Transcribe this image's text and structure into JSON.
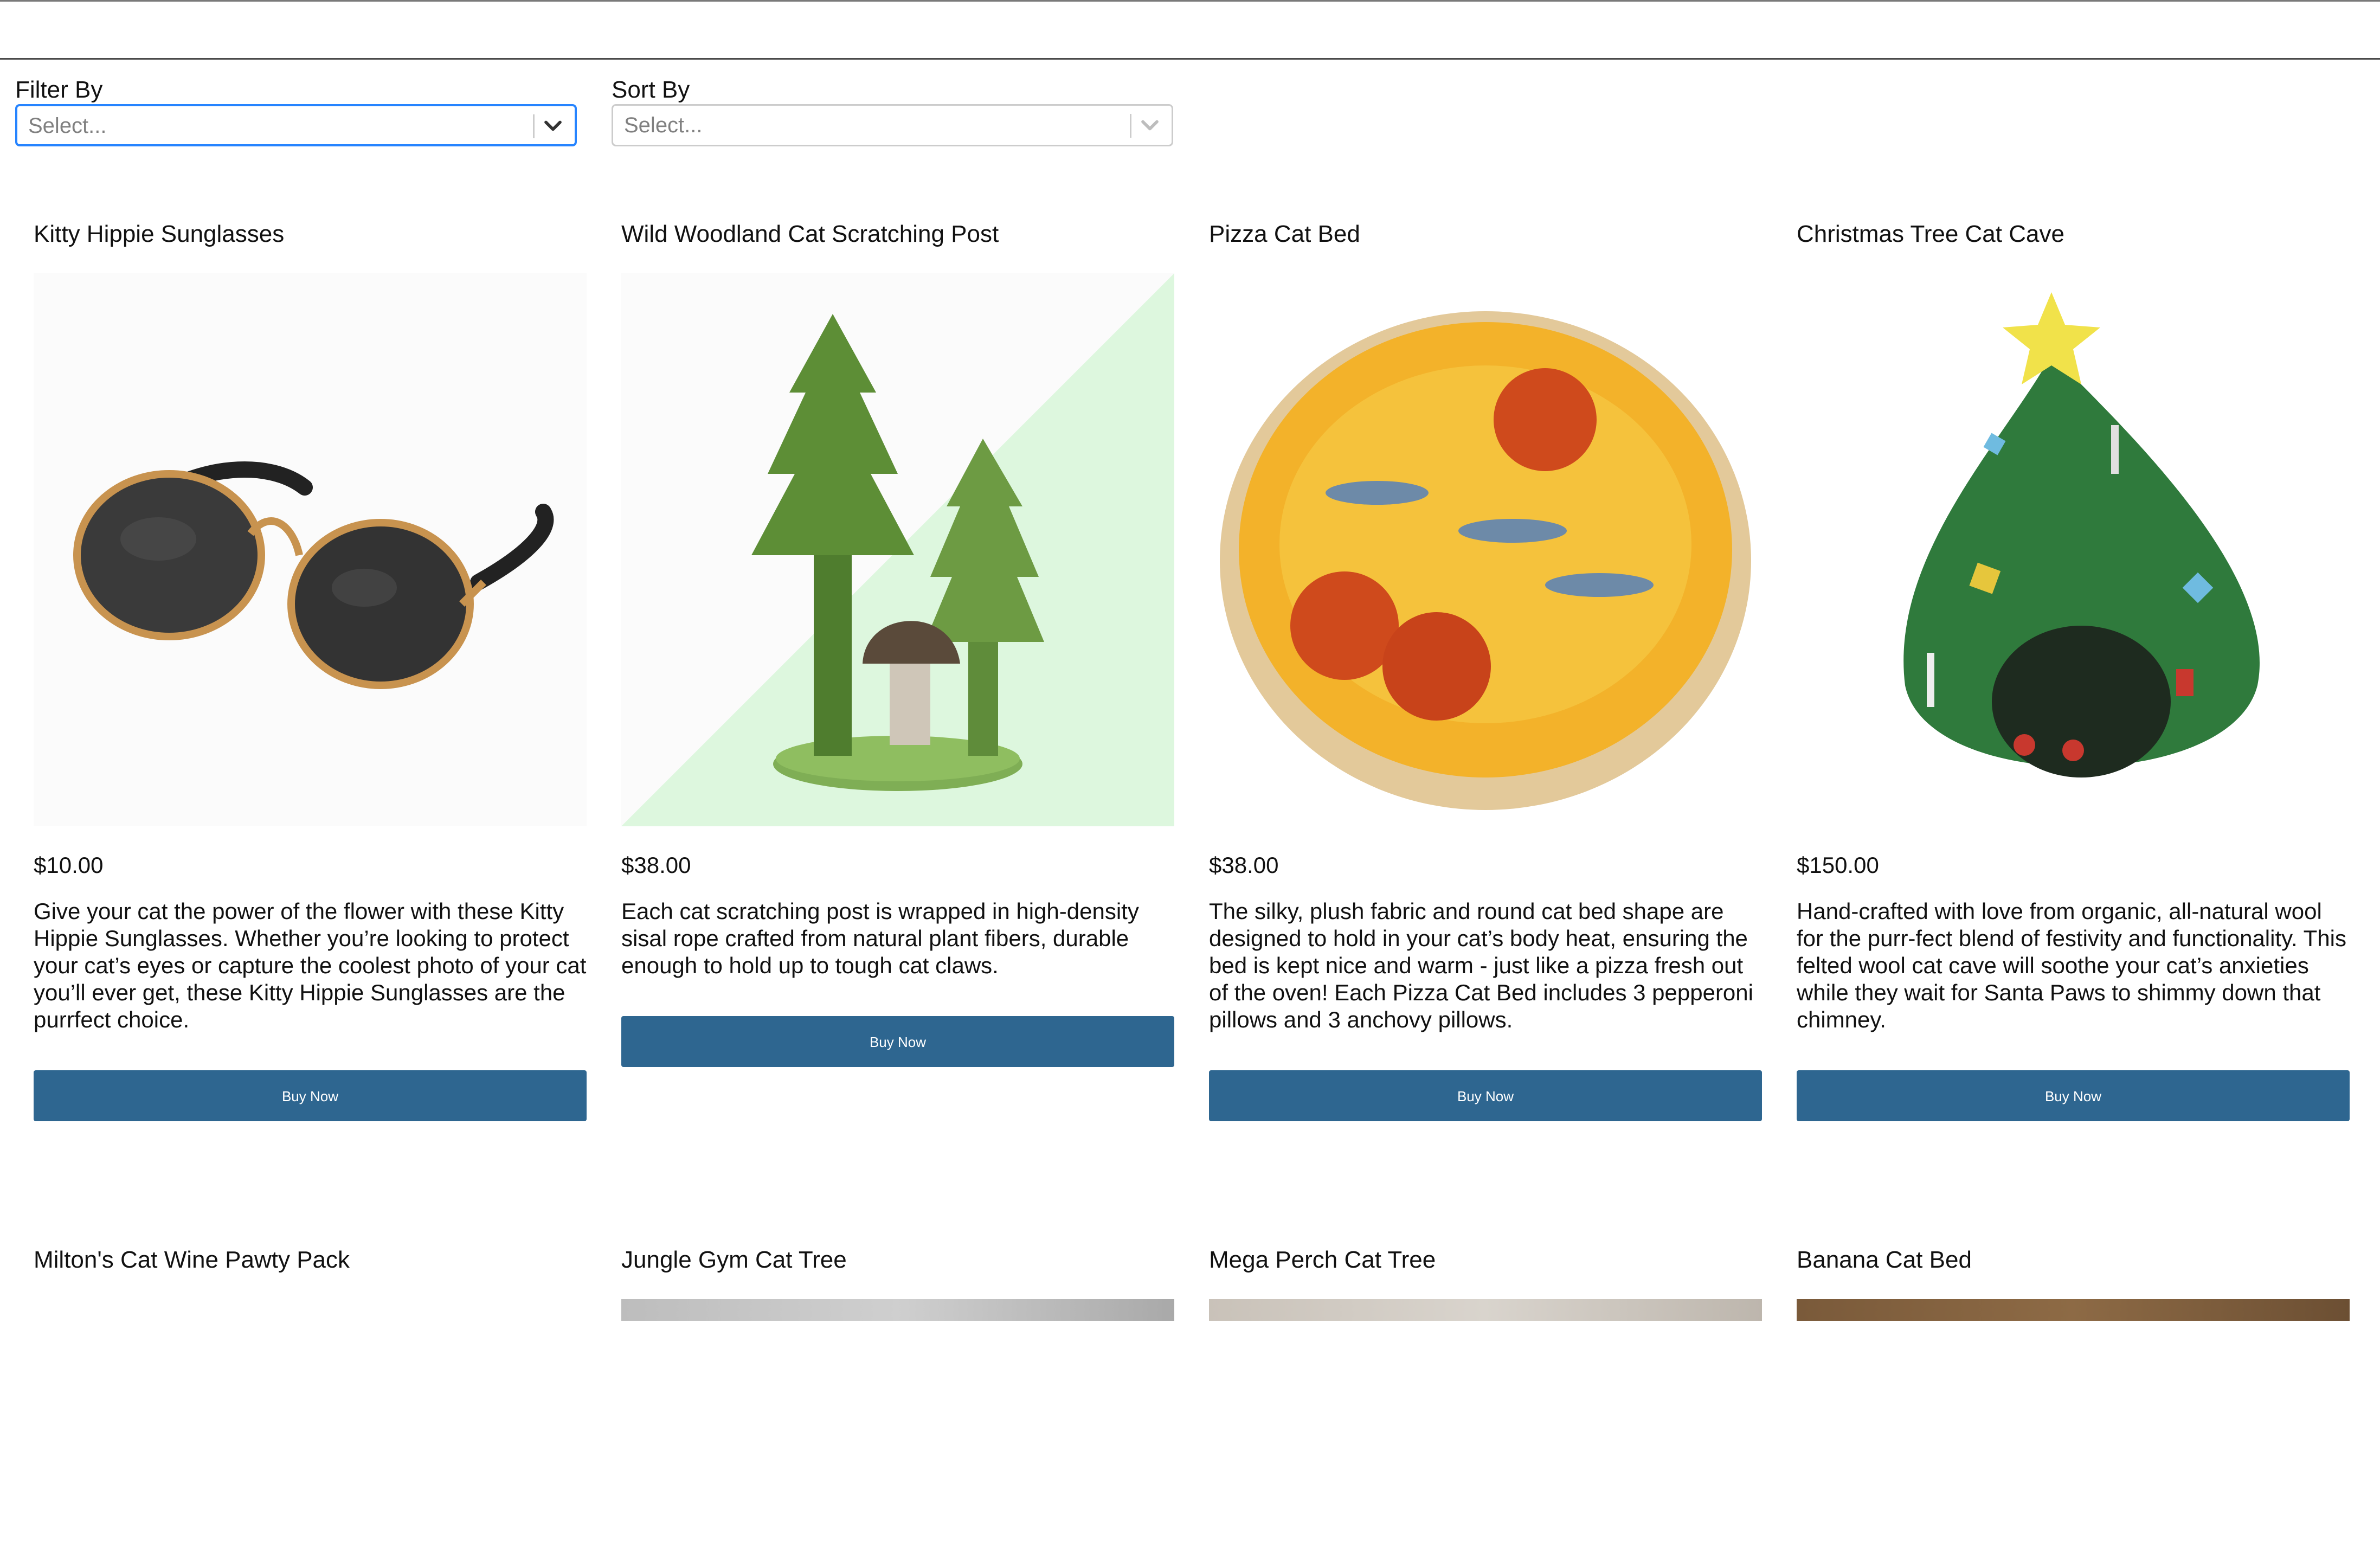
{
  "filters": {
    "filter_by": {
      "label": "Filter By",
      "placeholder": "Select..."
    },
    "sort_by": {
      "label": "Sort By",
      "placeholder": "Select..."
    }
  },
  "products": [
    {
      "title": "Kitty Hippie Sunglasses",
      "price": "$10.00",
      "description": "Give your cat the power of the flower with these Kitty Hippie Sunglasses. Whether you’re looking to protect your cat’s eyes or capture the coolest photo of your cat you’ll ever get, these Kitty Hippie Sunglasses are the purrfect choice.",
      "button": "Buy Now"
    },
    {
      "title": "Wild Woodland Cat Scratching Post",
      "price": "$38.00",
      "description": "Each cat scratching post is wrapped in high-density sisal rope crafted from natural plant fibers, durable enough to hold up to tough cat claws.",
      "button": "Buy Now"
    },
    {
      "title": "Pizza Cat Bed",
      "price": "$38.00",
      "description": "The silky, plush fabric and round cat bed shape are designed to hold in your cat’s body heat, ensuring the bed is kept nice and warm - just like a pizza fresh out of the oven! Each Pizza Cat Bed includes 3 pepperoni pillows and 3 anchovy pillows.",
      "button": "Buy Now"
    },
    {
      "title": "Christmas Tree Cat Cave",
      "price": "$150.00",
      "description": "Hand-crafted with love from organic, all-natural wool for the purr-fect blend of festivity and functionality. This felted wool cat cave will soothe your cat’s anxieties while they wait for Santa Paws to shimmy down that chimney.",
      "button": "Buy Now"
    },
    {
      "title": "Milton's Cat Wine Pawty Pack"
    },
    {
      "title": "Jungle Gym Cat Tree"
    },
    {
      "title": "Mega Perch Cat Tree"
    },
    {
      "title": "Banana Cat Bed"
    }
  ],
  "colors": {
    "button_bg": "#2e6690",
    "button_text": "#ffffff",
    "focus_border": "#2684ff",
    "input_border": "#cccccc"
  },
  "icons": {
    "select_chevron": "chevron-down-icon"
  }
}
